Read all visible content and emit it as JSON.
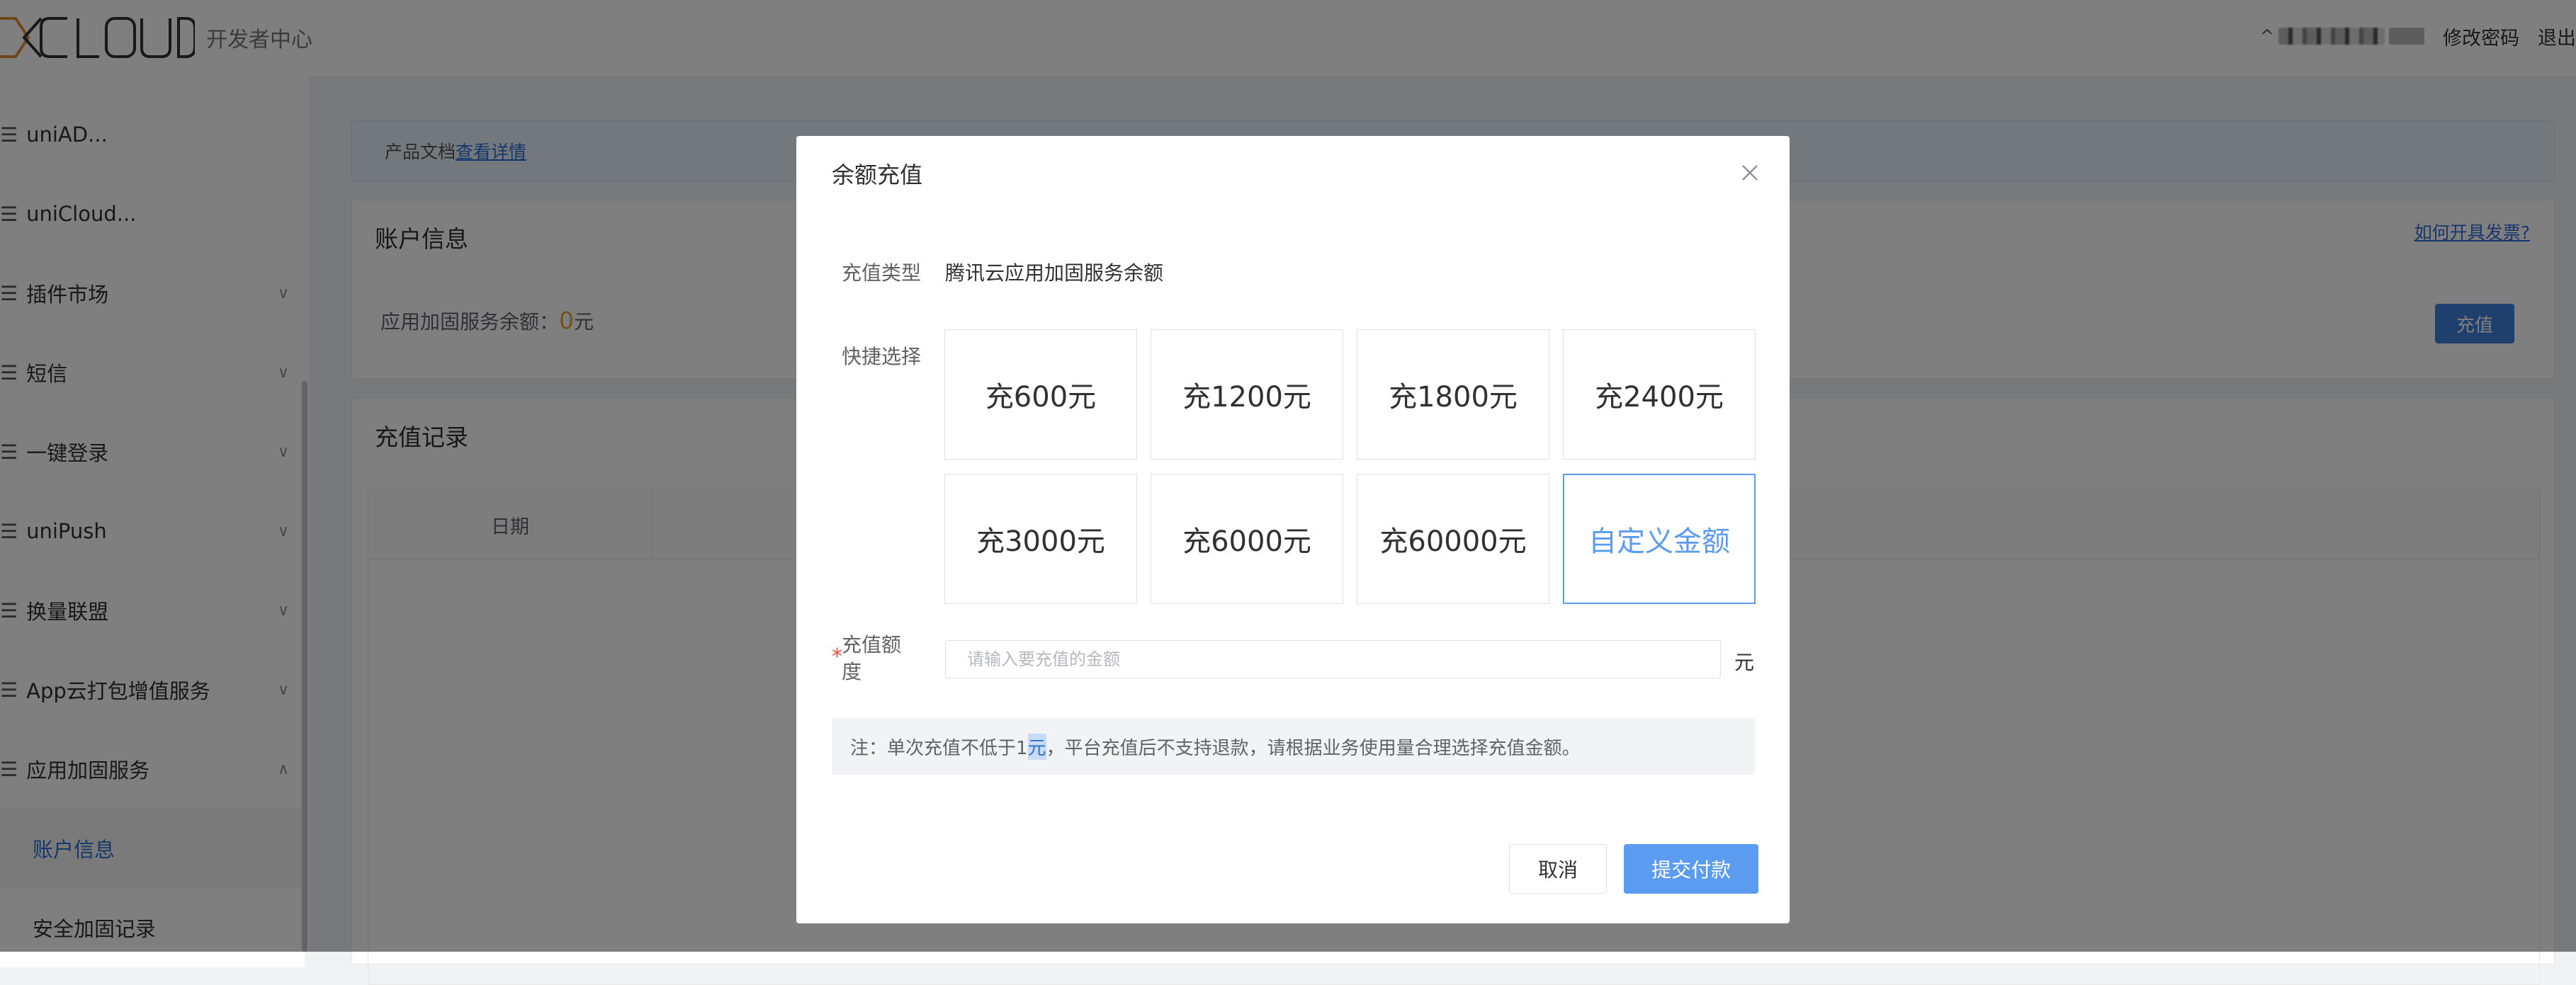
{
  "header": {
    "logo_alt": "DCLOUD",
    "subtitle": "开发者中心",
    "links": [
      "修改密码",
      "退出"
    ]
  },
  "sidebar": {
    "items": [
      {
        "label": "uniAD..."
      },
      {
        "label": "uniCloud..."
      },
      {
        "label": "插件市场"
      },
      {
        "label": "短信"
      },
      {
        "label": "一键登录"
      },
      {
        "label": "uniPush"
      },
      {
        "label": "换量联盟"
      },
      {
        "label": "App云打包增值服务"
      },
      {
        "label": "应用加固服务"
      }
    ],
    "sub_items": [
      {
        "label": "账户信息"
      },
      {
        "label": "安全加固记录"
      }
    ]
  },
  "main": {
    "notice_prefix": "产品文档",
    "notice_link": "查看详情",
    "account_title": "账户信息",
    "invoice_link": "如何开具发票?",
    "balance_label": "应用加固服务余额：",
    "balance_value": "0",
    "balance_unit": "元",
    "topup_label": "充值",
    "records_title": "充值记录",
    "table_columns": [
      "日期"
    ]
  },
  "modal": {
    "title": "余额充值",
    "type_label": "充值类型",
    "type_value": "腾讯云应用加固服务余额",
    "quick_label": "快捷选择",
    "options": [
      "充600元",
      "充1200元",
      "充1800元",
      "充2400元",
      "充3000元",
      "充6000元",
      "充60000元",
      "自定义金额"
    ],
    "selected_index": 7,
    "required_mark": "*",
    "amount_label": "充值额度",
    "amount_placeholder": "请输入要充值的金额",
    "amount_unit": "元",
    "note_prefix": "注：单次充值不低于1",
    "note_highlight": "元",
    "note_suffix": "，平台充值后不支持退款，请根据业务使用量合理选择充值金额。",
    "cancel_label": "取消",
    "submit_label": "提交付款"
  },
  "colors": {
    "primary": "#5b9cf0",
    "link": "#2f6fd6",
    "balance_number": "#e6a23c",
    "required": "#e64b3c"
  }
}
